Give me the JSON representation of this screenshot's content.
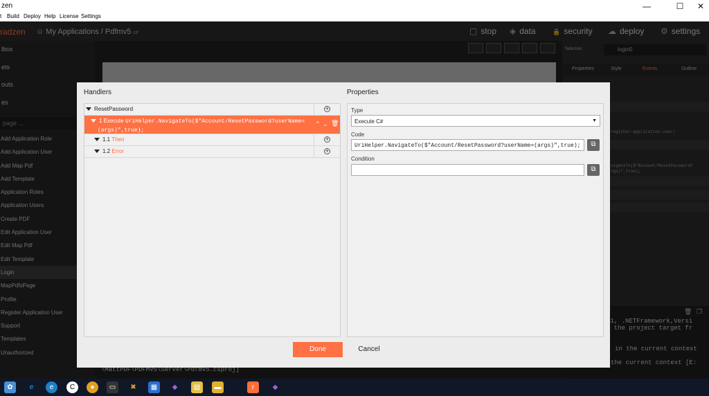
{
  "window": {
    "title": "zen",
    "min": "—",
    "max": "☐",
    "close": "✕"
  },
  "menu": [
    "t",
    "Build",
    "Deploy",
    "Help",
    "License",
    "Settings"
  ],
  "appbar": {
    "logo": "radzen",
    "breadcrumb": "My Applications / Pdfmv5",
    "lang_badge": "c#",
    "nav": [
      {
        "icon": "stop-icon",
        "glyph": "▢",
        "label": "stop"
      },
      {
        "icon": "data-icon",
        "glyph": "◈",
        "label": "data"
      },
      {
        "icon": "lock-icon",
        "glyph": "🔒",
        "label": "security"
      },
      {
        "icon": "cloud-icon",
        "glyph": "☁",
        "label": "deploy"
      },
      {
        "icon": "gear-icon",
        "glyph": "⚙",
        "label": "settings"
      }
    ]
  },
  "sidebar": {
    "top": [
      "lbox",
      "ets",
      "outs",
      "es"
    ],
    "search_placeholder": "page ...",
    "pages": [
      "Add Application Role",
      "Add Application User",
      "Add Map Pdf",
      "Add Template",
      "Application Roles",
      "Application Users",
      "Create PDF",
      "Edit Application User",
      "Edit Map Pdf",
      "Edit Template",
      "Login",
      "MapPdfsPage",
      "Profile",
      "Register Application User",
      "Support",
      "Templates",
      "Unauthorized"
    ],
    "active": "Login"
  },
  "right_panel": {
    "selection_label": "Selection",
    "selection_value": "login0",
    "tabs": [
      "Properties",
      "Style",
      "Events",
      "Outline"
    ],
    "active_tab": "Events",
    "snippet1": "/register-application-user/",
    "snippet2": "vigateTo($\"Account/ResetPassword?",
    "snippet3": "rgs)\",true);"
  },
  "console": {
    "lines": [
      ".1, .NETFramework,Versi",
      "f the project target fr",
      "in the current context",
      "the current context [E:"
    ],
    "path": "\\MattPDF\\PDFMV5\\Server\\Pdfmv5.csproj]"
  },
  "modal": {
    "handlers_title": "Handlers",
    "properties_title": "Properties",
    "event_name": "ResetPassword",
    "action_prefix": "1",
    "action_label": "Execute",
    "action_code": "UriHelper.NavigateTo($\"Account/ResetPassword?userName=",
    "action_code2": "(args)\",true);",
    "then_num": "1.1",
    "then_label": "Then",
    "error_num": "1.2",
    "error_label": "Error",
    "type_label": "Type",
    "type_value": "Execute C#",
    "code_label": "Code",
    "code_value": "UriHelper.NavigateTo($\"Account/ResetPassword?userName=(args)\",true);",
    "condition_label": "Condition",
    "condition_value": "",
    "done_label": "Done",
    "cancel_label": "Cancel"
  },
  "taskbar": [
    "radzen-app",
    "ie",
    "edge",
    "ccleaner",
    "chrome",
    "terminal",
    "tools",
    "store",
    "visual-studio",
    "files",
    "folder",
    "radzen",
    "visual-studio-2"
  ]
}
